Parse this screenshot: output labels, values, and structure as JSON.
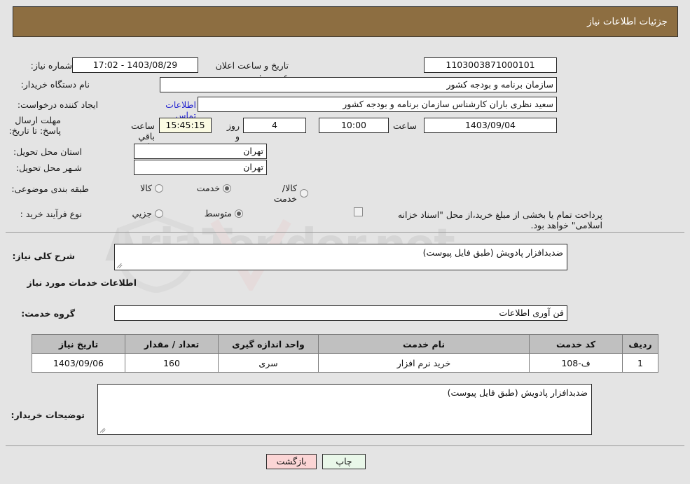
{
  "header": {
    "title": "جزئیات اطلاعات نیاز"
  },
  "form": {
    "need_number_label": "شماره نیاز:",
    "need_number_value": "1103003871000101",
    "buyer_org_label": "نام دستگاه خریدار:",
    "buyer_org_value": "سازمان برنامه و بودجه کشور",
    "creator_label": "ایجاد کننده درخواست:",
    "creator_value": "سعید نظری باران کارشناس سازمان برنامه و بودجه کشور",
    "deadline_label": "مهلت ارسال پاسخ: تا تاریخ:",
    "deadline_date": "1403/09/04",
    "hour_label": "ساعت",
    "deadline_time": "10:00",
    "days_remaining": "4",
    "days_label": "روز و",
    "countdown": "15:45:15",
    "remaining_label": "ساعت باقي مانده",
    "announce_label": "تاریخ و ساعت اعلان عمومي:",
    "announce_value": "1403/08/29 - 17:02",
    "contact_link": "اطلاعات تماس خریدار",
    "province_label": "استان محل تحویل:",
    "province_value": "تهران",
    "city_label": "شـهر محل تحویل:",
    "city_value": "تهران",
    "category_label": "طبقه بندی موضوعی:",
    "category_options": [
      "کالا",
      "خدمت",
      "کالا/خدمت"
    ],
    "category_selected": 1,
    "process_label": "نوع فرآیند خرید :",
    "process_options": [
      "جزيي",
      "متوسط"
    ],
    "process_selected": 1,
    "treasury_checkbox_text": "پرداخت تمام یا بخشی از مبلغ خرید،از محل \"اسناد خزانه اسلامی\" خواهد بود.",
    "treasury_checked": false
  },
  "description": {
    "label": "شرح کلی نیاز:",
    "value": "ضدبدافزار پادویش (طبق فایل پیوست)"
  },
  "services_section": {
    "heading": "اطلاعات خدمات مورد نیاز",
    "group_label": "گروه خدمت:",
    "group_value": "فن آوری اطلاعات"
  },
  "table": {
    "headers": [
      "ردیف",
      "کد خدمت",
      "نام خدمت",
      "واحد اندازه گیری",
      "تعداد / مقدار",
      "تاریخ نیاز"
    ],
    "rows": [
      [
        "1",
        "ف-108",
        "خرید نرم افزار",
        "سری",
        "160",
        "1403/09/06"
      ]
    ]
  },
  "buyer_notes": {
    "label": "توضیحات خریدار:",
    "value": "ضدبدافزار پادویش (طبق فایل پیوست)"
  },
  "footer": {
    "print_label": "چاپ",
    "back_label": "بازگشت"
  },
  "watermark": {
    "text": "AriaTender.net"
  },
  "colors": {
    "header_bg": "#8d6e41",
    "page_bg": "#e4e4e4",
    "link": "#2626d0",
    "highlight": "#fbfbe3",
    "print_btn": "#e9f7e9",
    "back_btn": "#fbd5d5"
  }
}
